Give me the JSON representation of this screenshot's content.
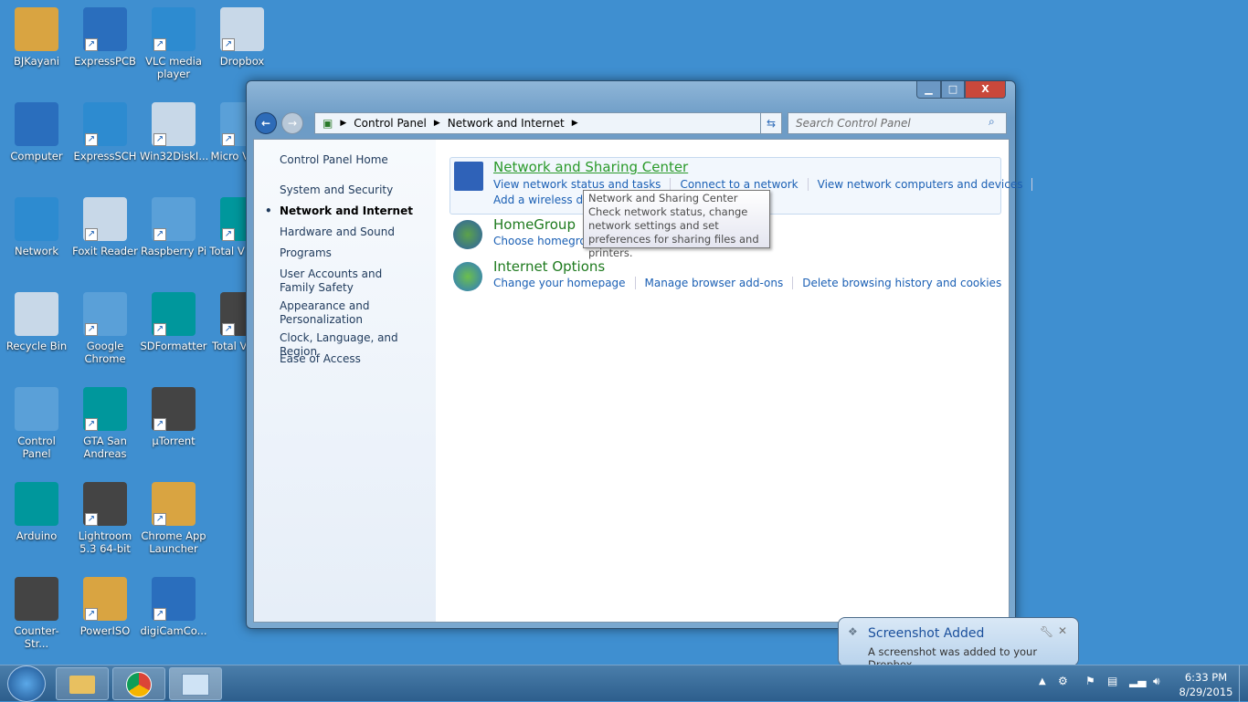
{
  "desktop": {
    "icons": [
      [
        "BJKayani",
        "Computer",
        "Network",
        "Recycle Bin",
        "Control Panel",
        "Arduino",
        "Counter-Str..."
      ],
      [
        "ExpressPCB",
        "ExpressSCH",
        "Foxit Reader",
        "Google Chrome",
        "GTA San Andreas",
        "Lightroom 5.3 64-bit",
        "PowerISO"
      ],
      [
        "VLC media player",
        "Win32DiskI...",
        "Raspberry Pi",
        "SDFormatter",
        "µTorrent",
        "Chrome App Launcher",
        "digiCamCo..."
      ],
      [
        "Dropbox",
        "Micro Visual",
        "Total V Conv",
        "Total V Play"
      ]
    ]
  },
  "window": {
    "buttons": {
      "minimize": "▁",
      "maximize": "□",
      "close": "X"
    },
    "breadcrumb": [
      "Control Panel",
      "Network and Internet"
    ],
    "search_placeholder": "Search Control Panel",
    "sidebar": {
      "home": "Control Panel Home",
      "items": [
        "System and Security",
        "Network and Internet",
        "Hardware and Sound",
        "Programs",
        "User Accounts and Family Safety",
        "Appearance and Personalization",
        "Clock, Language, and Region",
        "Ease of Access"
      ],
      "active": "Network and Internet"
    },
    "categories": [
      {
        "title": "Network and Sharing Center",
        "links": [
          "View network status and tasks",
          "Connect to a network",
          "View network computers and devices",
          "Add a wireless device to the network"
        ]
      },
      {
        "title": "HomeGroup",
        "links": [
          "Choose homegroup and sharing options"
        ]
      },
      {
        "title": "Internet Options",
        "links": [
          "Change your homepage",
          "Manage browser add-ons",
          "Delete browsing history and cookies"
        ]
      }
    ],
    "tooltip": {
      "title": "Network and Sharing Center",
      "body": "Check network status, change network settings and set preferences for sharing files and printers."
    }
  },
  "notification": {
    "title": "Screenshot Added",
    "body": "A screenshot was added to your Dropbox."
  },
  "taskbar": {
    "time": "6:33 PM",
    "date": "8/29/2015"
  },
  "colors": {
    "desktop": "#3f8fd0",
    "link": "#1a5fb4",
    "category": "#1e7a1e"
  }
}
